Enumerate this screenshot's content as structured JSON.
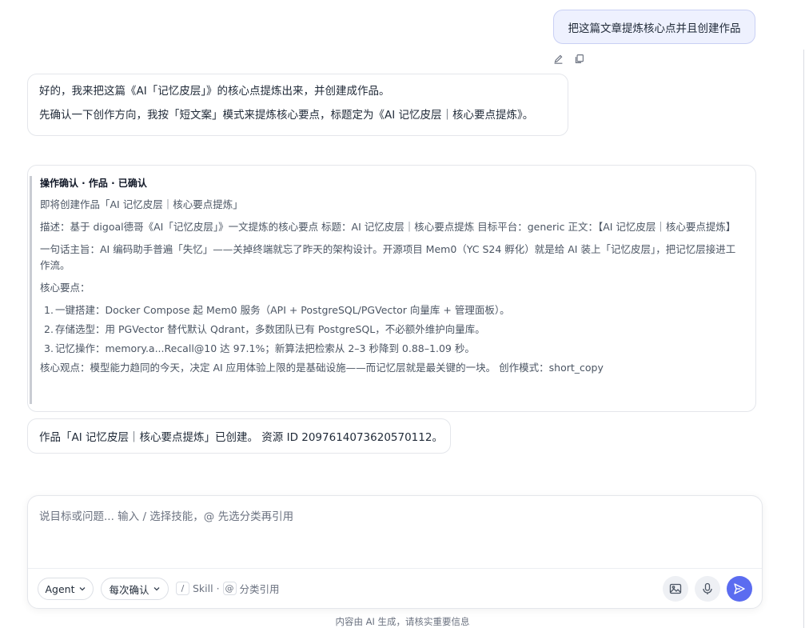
{
  "user_message": "把这篇文章提炼核心点并且创建作品",
  "reply": {
    "line1": "好的，我来把这篇《AI「记忆皮层」》的核心点提炼出来，并创建成作品。",
    "line2": "先确认一下创作方向，我按「短文案」模式来提炼核心要点，标题定为《AI 记忆皮层｜核心要点提炼》。"
  },
  "confirm_card": {
    "title": "操作确认 · 作品 · 已确认",
    "intro": "即将创建作品「AI 记忆皮层｜核心要点提炼」",
    "description": "描述：基于 digoal德哥《AI「记忆皮层」》一文提炼的核心要点 标题：AI 记忆皮层｜核心要点提炼 目标平台：generic 正文：【AI 记忆皮层｜核心要点提炼】",
    "summary": "一句话主旨：AI 编码助手普遍「失忆」——关掉终端就忘了昨天的架构设计。开源项目 Mem0（YC S24 孵化）就是给 AI 装上「记忆皮层」，把记忆层接进工作流。",
    "points_label": "核心要点：",
    "points": [
      {
        "num": "1.",
        "text": "一键搭建：Docker Compose 起 Mem0 服务（API + PostgreSQL/PGVector 向量库 + 管理面板）。"
      },
      {
        "num": "2.",
        "text": "存储选型：用 PGVector 替代默认 Qdrant，多数团队已有 PostgreSQL，不必额外维护向量库。"
      },
      {
        "num": "3.",
        "text": "记忆操作：memory.a...Recall@10 达 97.1%；新算法把检索从 2–3 秒降到 0.88–1.09 秒。"
      }
    ],
    "conclusion": "核心观点：模型能力趋同的今天，决定 AI 应用体验上限的是基础设施——而记忆层就是最关键的一块。 创作模式：short_copy"
  },
  "result_message": "作品「AI 记忆皮层｜核心要点提炼」已创建。 资源 ID 2097614073620570112。",
  "composer": {
    "placeholder": "说目标或问题... 输入 / 选择技能，@ 先选分类再引用",
    "agent_label": "Agent",
    "confirm_mode_label": "每次确认",
    "slash_key": "/",
    "skill_label": "Skill ·",
    "at_key": "@",
    "category_label": "分类引用"
  },
  "footer_note": "内容由 AI 生成，请核实重要信息",
  "colors": {
    "accent": "#5b6cf0",
    "user_bubble_bg": "#eef1fe",
    "user_bubble_border": "#c9d0f4"
  }
}
